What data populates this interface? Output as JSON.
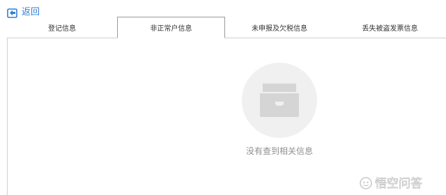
{
  "back": {
    "label": "返回",
    "icon": "back-arrow-icon"
  },
  "tabs": [
    {
      "label": "登记信息"
    },
    {
      "label": "非正常户信息"
    },
    {
      "label": "未申报及欠税信息"
    },
    {
      "label": "丢失被盗发票信息"
    }
  ],
  "active_tab": "非正常户信息",
  "empty_state": {
    "icon": "empty-inbox-icon",
    "message": "没有查到相关信息"
  },
  "watermark": {
    "text": "悟空问答",
    "icon": "watermark-logo-icon"
  },
  "colors": {
    "link": "#2f7fd1",
    "muted_text": "#8f8f8f",
    "empty_bg": "#f0f0f0",
    "empty_icon": "#d5d5d5"
  }
}
